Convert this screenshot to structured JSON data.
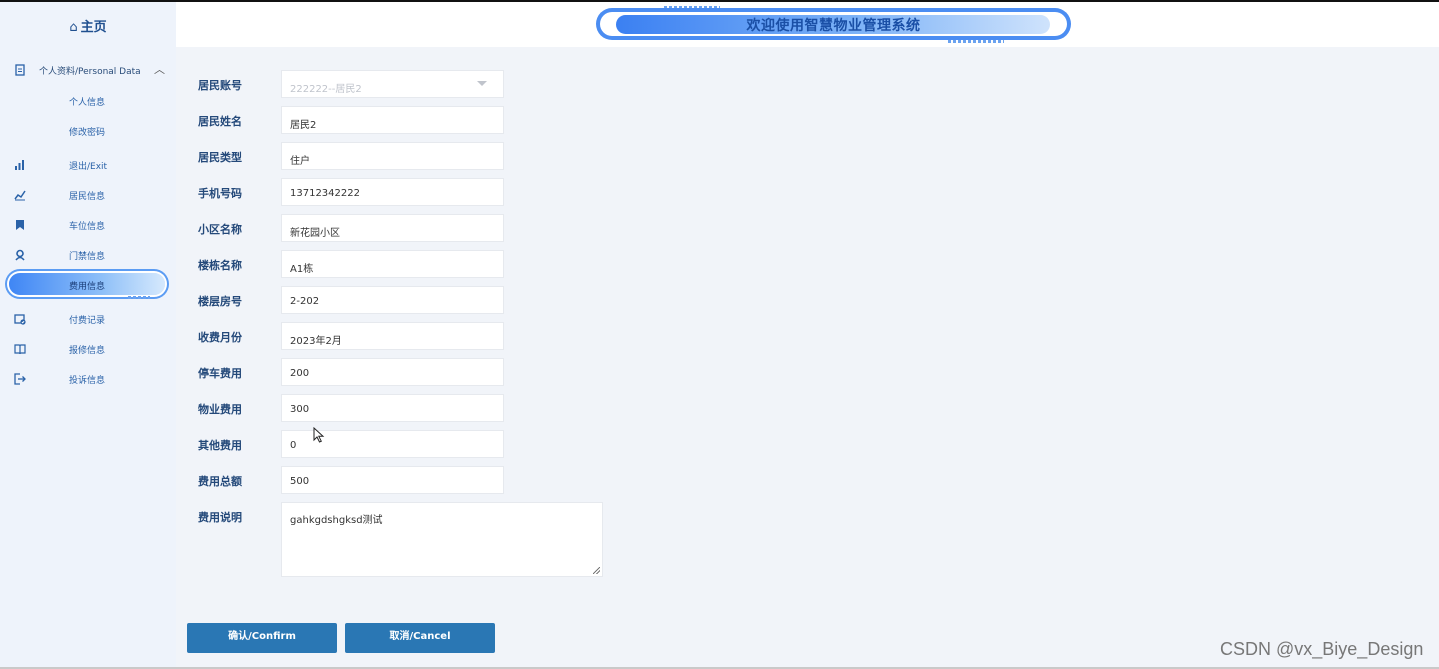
{
  "header": {
    "title": "欢迎使用智慧物业管理系统"
  },
  "sidebar": {
    "home_label": "主页",
    "parent": {
      "label": "个人资料/Personal Data",
      "children": [
        "个人信息",
        "修改密码"
      ]
    },
    "items": [
      {
        "label": "退出/Exit",
        "icon": "bar-chart-icon"
      },
      {
        "label": "居民信息",
        "icon": "line-chart-icon"
      },
      {
        "label": "车位信息",
        "icon": "bookmark-icon"
      },
      {
        "label": "门禁信息",
        "icon": "user-badge-icon"
      },
      {
        "label": "费用信息",
        "icon": "",
        "active": true
      },
      {
        "label": "付费记录",
        "icon": "calendar-check-icon"
      },
      {
        "label": "报修信息",
        "icon": "book-icon"
      },
      {
        "label": "投诉信息",
        "icon": "logout-icon"
      }
    ]
  },
  "form": {
    "fields": [
      {
        "label": "居民账号",
        "value": "222222--居民2",
        "disabled": true,
        "type": "select"
      },
      {
        "label": "居民姓名",
        "value": "居民2"
      },
      {
        "label": "居民类型",
        "value": "住户"
      },
      {
        "label": "手机号码",
        "value": "13712342222"
      },
      {
        "label": "小区名称",
        "value": "新花园小区"
      },
      {
        "label": "楼栋名称",
        "value": "A1栋"
      },
      {
        "label": "楼层房号",
        "value": "2-202"
      },
      {
        "label": "收费月份",
        "value": "2023年2月"
      },
      {
        "label": "停车费用",
        "value": "200"
      },
      {
        "label": "物业费用",
        "value": "300"
      },
      {
        "label": "其他费用",
        "value": "0"
      },
      {
        "label": "费用总额",
        "value": "500"
      }
    ],
    "description": {
      "label": "费用说明",
      "value": "gahkgdshgksd测试"
    }
  },
  "buttons": {
    "confirm": "确认/Confirm",
    "cancel": "取消/Cancel"
  },
  "watermark": "CSDN @vx_Biye_Design",
  "colors": {
    "accent": "#2a77b4",
    "sidebar_text": "#2a62a8",
    "label": "#24497a"
  }
}
